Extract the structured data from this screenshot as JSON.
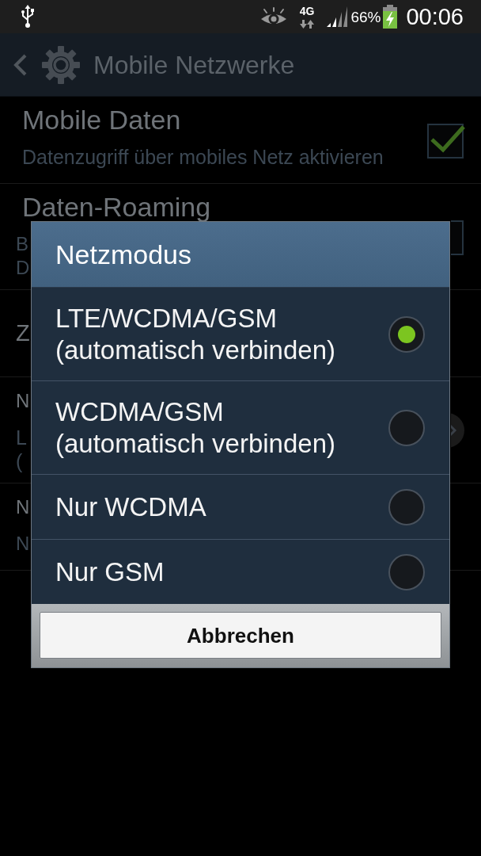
{
  "status_bar": {
    "network_type": "4G",
    "battery_percent": "66%",
    "time": "00:06"
  },
  "action_bar": {
    "title": "Mobile Netzwerke"
  },
  "settings": [
    {
      "kind": "checkbox",
      "title": "Mobile Daten",
      "subtitle": "Datenzugriff über mobiles Netz aktivieren",
      "checked": true
    },
    {
      "kind": "checkbox",
      "title": "Daten-Roaming",
      "subtitle": "B\nD",
      "checked": false
    },
    {
      "kind": "plain",
      "title": "Z"
    },
    {
      "kind": "more",
      "title": "N",
      "subtitle": "L\n("
    },
    {
      "kind": "plain",
      "title": "N",
      "subtitle": "N"
    }
  ],
  "dialog": {
    "title": "Netzmodus",
    "options": [
      {
        "label": "LTE/WCDMA/GSM\n(automatisch verbinden)",
        "selected": true
      },
      {
        "label": "WCDMA/GSM\n(automatisch verbinden)",
        "selected": false
      },
      {
        "label": "Nur WCDMA",
        "selected": false
      },
      {
        "label": "Nur GSM",
        "selected": false
      }
    ],
    "buttons": [
      "Abbrechen"
    ]
  }
}
